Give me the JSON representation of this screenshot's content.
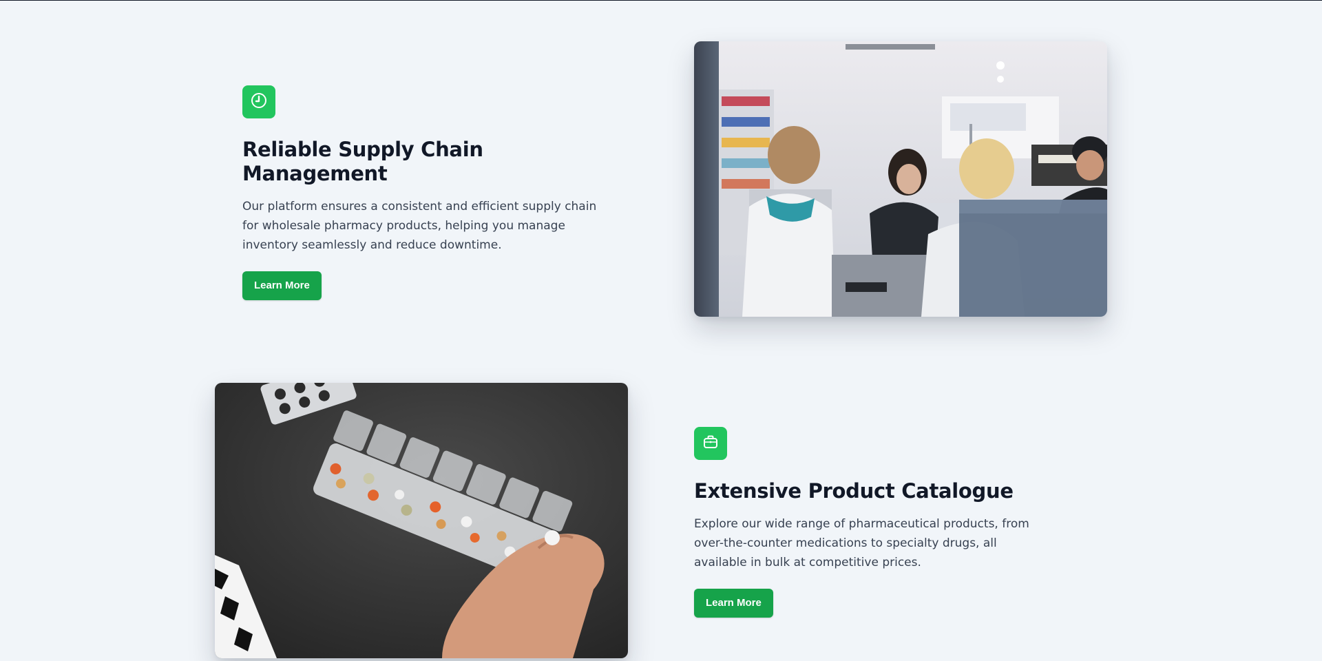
{
  "features": [
    {
      "icon": "clock-icon",
      "title": "Reliable Supply Chain Management",
      "description": "Our platform ensures a consistent and efficient supply chain for wholesale pharmacy products, helping you manage inventory seamlessly and reduce downtime.",
      "button_label": "Learn More",
      "image": "pharmacy-counter-photo"
    },
    {
      "icon": "briefcase-icon",
      "title": "Extensive Product Catalogue",
      "description": "Explore our wide range of pharmaceutical products, from over-the-counter medications to specialty drugs, all available in bulk at competitive prices.",
      "button_label": "Learn More",
      "image": "pill-organizer-photo"
    }
  ],
  "colors": {
    "accent": "#22c55e",
    "button": "#16a34a",
    "background": "#f1f5f9",
    "heading": "#111827"
  }
}
